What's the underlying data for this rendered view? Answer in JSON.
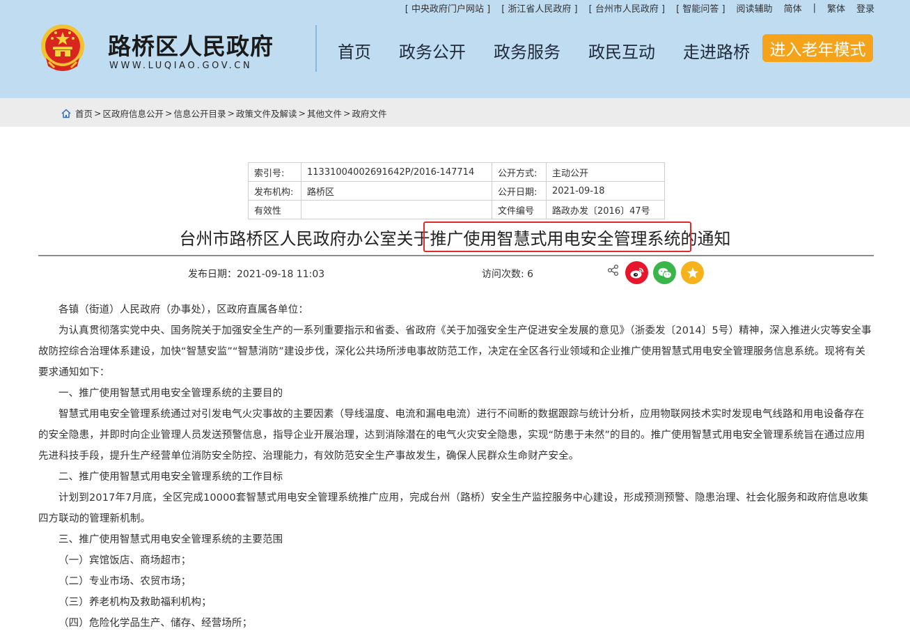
{
  "top_links": {
    "central_gov": "中央政府门户网站",
    "zhejiang_gov": "浙江省人民政府",
    "taizhou_gov": "台州市人民政府",
    "smart_qa": "智能问答",
    "reading_aid": "阅读辅助",
    "simplified": "简体",
    "separator": "|",
    "traditional": "繁体",
    "login": "登录"
  },
  "header": {
    "site_name": "路桥区人民政府",
    "site_url": "WWW.LUQIAO.GOV.CN",
    "nav": [
      "首页",
      "政务公开",
      "政务服务",
      "政民互动",
      "走进路桥"
    ],
    "elder_mode": "进入老年模式"
  },
  "breadcrumb": [
    "首页",
    "区政府信息公开",
    "信息公开目录",
    "政策文件及解读",
    "其他文件",
    "政府文件"
  ],
  "meta_table": {
    "index_label": "索引号:",
    "index_value": "11331004002691642P/2016-147714",
    "disclosure_label": "公开方式:",
    "disclosure_value": "主动公开",
    "publisher_label": "发布机构:",
    "publisher_value": "路桥区",
    "disclosure_date_label": "公开日期:",
    "disclosure_date_value": "2021-09-18",
    "validity_label": "有效性",
    "validity_value": "",
    "doc_number_label": "文件编号",
    "doc_number_value": "路政办发〔2016〕47号"
  },
  "article": {
    "title": "台州市路桥区人民政府办公室关于推广使用智慧式用电安全管理系统的通知",
    "publish_date": "发布日期：2021-09-18 11:03",
    "visits": "访问次数: 6",
    "paragraphs": [
      "各镇（街道）人民政府（办事处），区政府直属各单位：",
      "为认真贯彻落实党中央、国务院关于加强安全生产的一系列重要指示和省委、省政府《关于加强安全生产促进安全发展的意见》（浙委发〔2014〕5号）精神，深入推进火灾等安全事故防控综合治理体系建设，加快“智慧安监”“智慧消防”建设步伐，深化公共场所涉电事故防范工作，决定在全区各行业领域和企业推广使用智慧式用电安全管理服务信息系统。现将有关要求通知如下：",
      "一、推广使用智慧式用电安全管理系统的主要目的",
      "智慧式用电安全管理系统通过对引发电气火灾事故的主要因素（导线温度、电流和漏电电流）进行不间断的数据跟踪与统计分析，应用物联网技术实时发现电气线路和用电设备存在的安全隐患，并即时向企业管理人员发送预警信息，指导企业开展治理，达到消除潜在的电气火灾安全隐患，实现“防患于未然”的目的。推广使用智慧式用电安全管理系统旨在通过应用先进科技手段，提升生产经营单位消防安全防控、治理能力，有效防范安全生产事故发生，确保人民群众生命财产安全。",
      "二、推广使用智慧式用电安全管理系统的工作目标",
      "计划到2017年7月底，全区完成10000套智慧式用电安全管理系统推广应用，完成台州（路桥）安全生产监控服务中心建设，形成预测预警、隐患治理、社会化服务和政府信息收集四方联动的管理新机制。",
      "三、推广使用智慧式用电安全管理系统的主要范围",
      "（一）宾馆饭店、商场超市；",
      "（二）专业市场、农贸市场；",
      "（三）养老机构及救助福利机构；",
      "（四）危险化学品生产、储存、经营场所；"
    ]
  },
  "colors": {
    "header_bg": "#bfdcf1",
    "elder_button": "#f5a31a",
    "highlight_box": "#e02a2a",
    "weibo": "#e6162d",
    "wechat": "#3ab54a",
    "favorite": "#f5b21b"
  },
  "icons": [
    "national-emblem-icon",
    "home-icon",
    "share-icon",
    "weibo-icon",
    "wechat-icon",
    "favorite-star-icon"
  ]
}
